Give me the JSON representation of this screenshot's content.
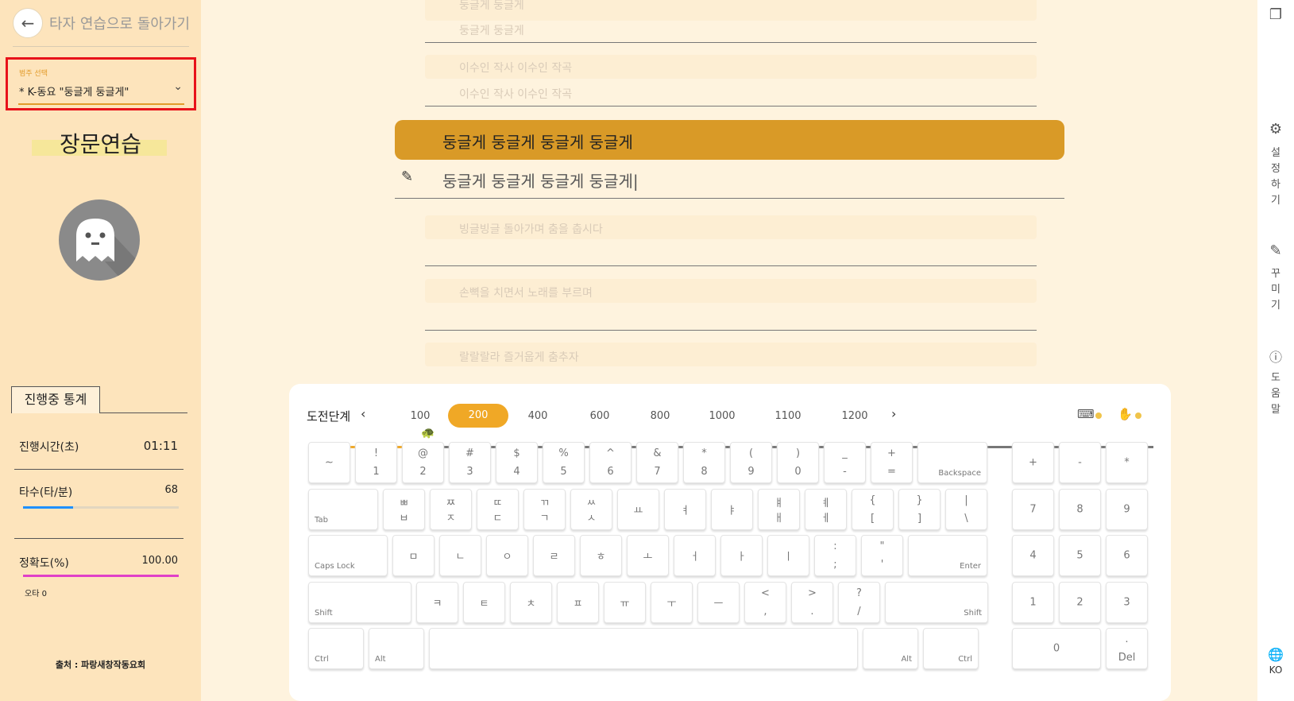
{
  "header": {
    "back_label": "타자 연습으로 돌아가기"
  },
  "song_select": {
    "label": "범주 선택",
    "value": "* K-동요 \"둥글게 둥글게\""
  },
  "mode_title": "장문연습",
  "stats": {
    "tab": "진행중 통계",
    "time_label": "진행시간(초)",
    "time_value": "01:11",
    "speed_label": "타수(타/분)",
    "speed_value": "68",
    "speed_fraction": 0.32,
    "accuracy_label": "정확도(%)",
    "accuracy_value": "100.00",
    "accuracy_fraction": 1.0,
    "typo_label": "오타 0"
  },
  "source": "출처 : 파랑새창작동요회",
  "lines": {
    "prev1_a": "둥글게 둥글게",
    "prev1_b": "둥글게 둥글게",
    "prev2_a": "이수인 작사 이수인 작곡",
    "prev2_b": "이수인 작사 이수인 작곡",
    "current": "둥글게 둥글게 둥글게 둥글게",
    "typed": "둥글게 둥글게 둥글게 둥글게|",
    "next1": "빙글빙글 돌아가며 춤을 춥시다",
    "next2": "손뼉을 치면서 노래를 부르며",
    "next3": "랄랄랄라 즐거웁게 춤추자"
  },
  "keyboard": {
    "stage_label": "도전단계",
    "stages": [
      "100",
      "200",
      "400",
      "600",
      "800",
      "1000",
      "1100",
      "1200"
    ],
    "selected_stage": "200",
    "rows": {
      "r1": [
        [
          "~",
          ""
        ],
        [
          "!",
          "1"
        ],
        [
          "@",
          "2"
        ],
        [
          "#",
          "3"
        ],
        [
          "$",
          "4"
        ],
        [
          "%",
          "5"
        ],
        [
          "^",
          "6"
        ],
        [
          "&",
          "7"
        ],
        [
          "*",
          "8"
        ],
        [
          "(",
          "9"
        ],
        [
          ")",
          "0"
        ],
        [
          "_",
          "-"
        ],
        [
          "+",
          "="
        ]
      ],
      "backspace": "Backspace",
      "tab": "Tab",
      "r2": [
        [
          "ㅃ",
          "ㅂ"
        ],
        [
          "ㅉ",
          "ㅈ"
        ],
        [
          "ㄸ",
          "ㄷ"
        ],
        [
          "ㄲ",
          "ㄱ"
        ],
        [
          "ㅆ",
          "ㅅ"
        ],
        [
          "",
          "ㅛ"
        ],
        [
          "",
          "ㅕ"
        ],
        [
          "",
          "ㅑ"
        ],
        [
          "ㅒ",
          "ㅐ"
        ],
        [
          "ㅖ",
          "ㅔ"
        ],
        [
          "{",
          "["
        ],
        [
          "}",
          "]"
        ],
        [
          "|",
          "\\"
        ]
      ],
      "caps": "Caps Lock",
      "r3": [
        [
          "",
          "ㅁ"
        ],
        [
          "",
          "ㄴ"
        ],
        [
          "",
          "ㅇ"
        ],
        [
          "",
          "ㄹ"
        ],
        [
          "",
          "ㅎ"
        ],
        [
          "",
          "ㅗ"
        ],
        [
          "",
          "ㅓ"
        ],
        [
          "",
          "ㅏ"
        ],
        [
          "",
          "ㅣ"
        ],
        [
          ":",
          ";"
        ],
        [
          "\"",
          "'"
        ]
      ],
      "enter": "Enter",
      "shift": "Shift",
      "r4": [
        [
          "",
          "ㅋ"
        ],
        [
          "",
          "ㅌ"
        ],
        [
          "",
          "ㅊ"
        ],
        [
          "",
          "ㅍ"
        ],
        [
          "",
          "ㅠ"
        ],
        [
          "",
          "ㅜ"
        ],
        [
          "",
          "ㅡ"
        ],
        [
          "<",
          ","
        ],
        [
          ">",
          "."
        ],
        [
          "?",
          "/"
        ]
      ],
      "ctrl": "Ctrl",
      "alt": "Alt"
    },
    "numpad": [
      "+",
      "-",
      "*",
      "7",
      "8",
      "9",
      "4",
      "5",
      "6",
      "1",
      "2",
      "3",
      "0"
    ],
    "numpad_del_top": ".",
    "numpad_del": "Del"
  },
  "right_bar": {
    "settings": [
      "설",
      "정",
      "하",
      "기"
    ],
    "decorate": [
      "꾸",
      "미",
      "기"
    ],
    "help": [
      "도",
      "움",
      "말"
    ],
    "lang": "KO"
  }
}
